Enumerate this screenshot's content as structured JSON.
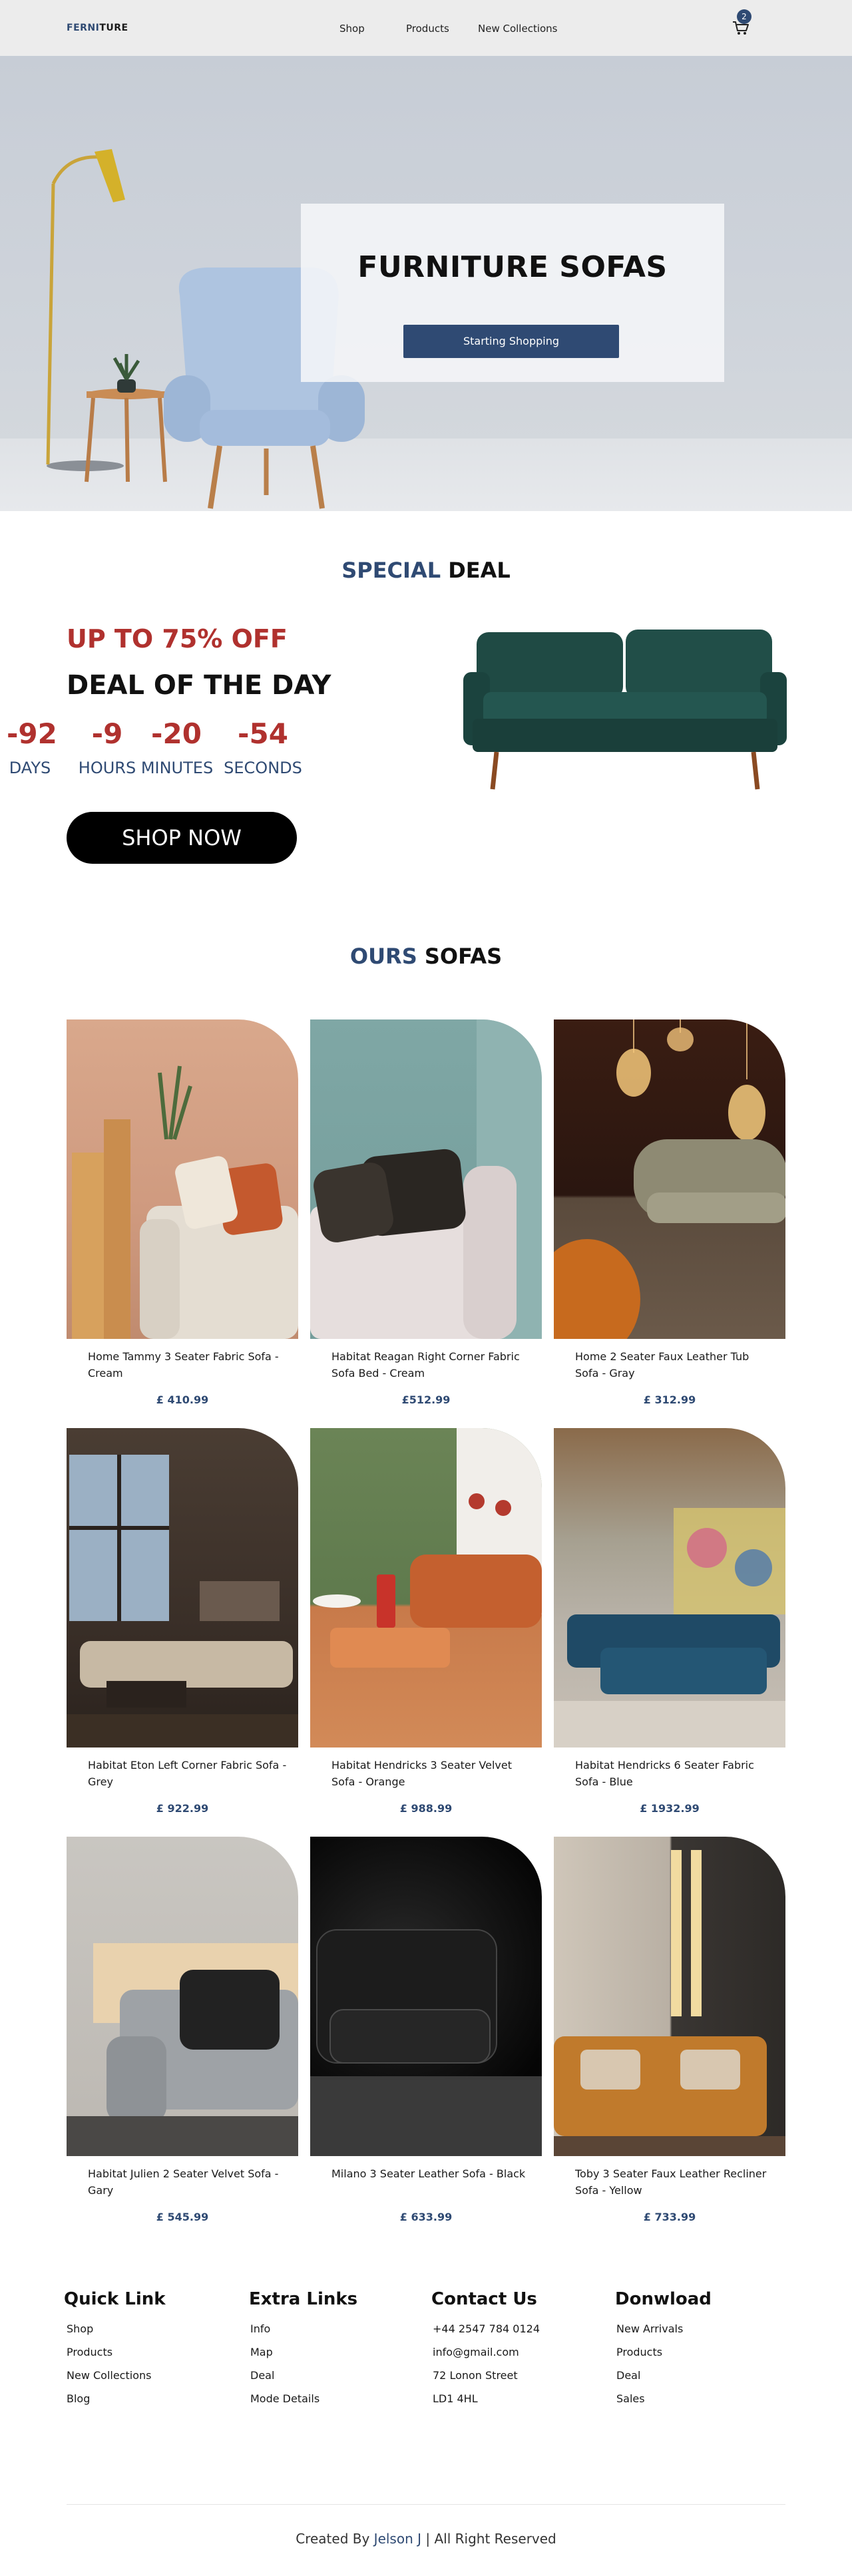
{
  "header": {
    "logo_part1": "FERNI",
    "logo_part2": "TURE",
    "nav": [
      "Shop",
      "Products",
      "New Collections"
    ],
    "cart_count": "2"
  },
  "hero": {
    "title": "FURNITURE SOFAS",
    "button_label": "Starting Shopping"
  },
  "special_deal": {
    "title_blue": "SPECIAL",
    "title_black": " DEAL",
    "discount": "UP TO 75% OFF",
    "subtitle": "DEAL OF THE DAY",
    "countdown": [
      {
        "value": "-92",
        "label": "DAYS"
      },
      {
        "value": "-9",
        "label": "HOURS"
      },
      {
        "value": "-20",
        "label": "MINUTES"
      },
      {
        "value": "-54",
        "label": "SECONDS"
      }
    ],
    "cta": "SHOP NOW"
  },
  "products_section": {
    "title_blue": "OURS",
    "title_black": " SOFAS",
    "items": [
      {
        "name": "Home Tammy 3 Seater Fabric Sofa - Cream",
        "price": "£ 410.99"
      },
      {
        "name": "Habitat Reagan Right Corner Fabric Sofa Bed - Cream",
        "price": "£512.99"
      },
      {
        "name": "Home 2 Seater Faux Leather Tub Sofa - Gray",
        "price": "£ 312.99"
      },
      {
        "name": "Habitat Eton Left Corner Fabric Sofa - Grey",
        "price": "£ 922.99"
      },
      {
        "name": "Habitat Hendricks 3 Seater Velvet Sofa - Orange",
        "price": "£ 988.99"
      },
      {
        "name": "Habitat Hendricks 6 Seater Fabric Sofa - Blue",
        "price": "£ 1932.99"
      },
      {
        "name": "Habitat Julien 2 Seater Velvet Sofa - Gary",
        "price": "£ 545.99"
      },
      {
        "name": "Milano 3 Seater Leather Sofa - Black",
        "price": "£ 633.99"
      },
      {
        "name": "Toby 3 Seater Faux Leather Recliner Sofa - Yellow",
        "price": "£ 733.99"
      }
    ]
  },
  "footer": {
    "columns": [
      {
        "heading": "Quick Link",
        "items": [
          "Shop",
          "Products",
          "New Collections",
          "Blog"
        ]
      },
      {
        "heading": "Extra Links",
        "items": [
          "Info",
          "Map",
          "Deal",
          "Mode Details"
        ]
      },
      {
        "heading": "Contact Us",
        "items": [
          "+44 2547 784 0124",
          "info@gmail.com",
          "72 Lonon Street",
          "LD1 4HL"
        ]
      },
      {
        "heading": "Donwload",
        "items": [
          "New Arrivals",
          "Products",
          "Deal",
          "Sales"
        ]
      }
    ],
    "credit_prefix": "Created By ",
    "credit_name": "Jelson J",
    "credit_suffix": " | All Right Reserved"
  }
}
